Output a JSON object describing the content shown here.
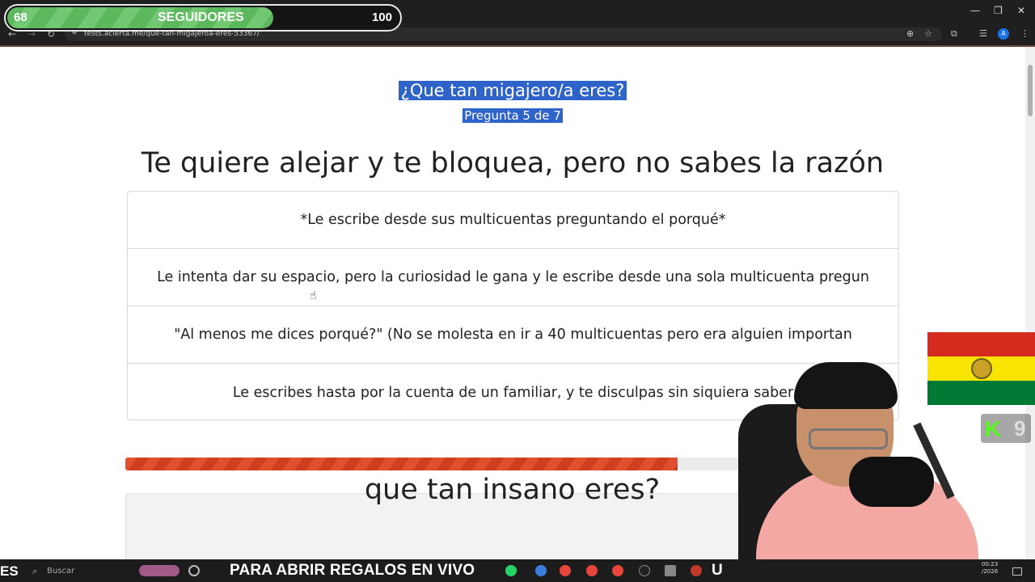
{
  "overlay": {
    "followers_current": "68",
    "followers_label": "SEGUIDORES",
    "followers_goal": "100",
    "progress_fraction": 0.68
  },
  "browser": {
    "url": "tests.acierta.me/que-tan-migajeroa-eres-53367/",
    "profile_initial": "A"
  },
  "quiz": {
    "title": "¿Que tan migajero/a eres?",
    "subtitle": "Pregunta 5 de 7",
    "question": "Te quiere alejar y te bloquea, pero no sabes la razón",
    "answers": [
      "*Le escribe desde sus multicuentas preguntando el porqué*",
      "Le intenta dar su espacio, pero la curiosidad le gana y le escribe desde una sola multicuenta pregun",
      "\"Al menos me dices porqué?\" (No se molesta en ir a 40 multicuentas pero era alguien importan",
      "Le escribes hasta por la cuenta de un familiar, y te disculpas sin siquiera saber"
    ],
    "progress_fraction": 0.714,
    "next_quiz_title": "que tan insano eres?"
  },
  "stream": {
    "kick_count": "9"
  },
  "taskbar": {
    "left_text": "ES",
    "search_placeholder": "Buscar",
    "ticker": "PARA ABRIR REGALOS EN VIVO",
    "ticker_tail": "U",
    "clock_time": "00:23",
    "clock_date": "/2026"
  },
  "colors": {
    "selection": "#2e63c9",
    "progress": "#e0502c",
    "follow_bar": "#5cb85c",
    "flag_red": "#d52b1e",
    "flag_yellow": "#f9e300",
    "flag_green": "#007934"
  }
}
